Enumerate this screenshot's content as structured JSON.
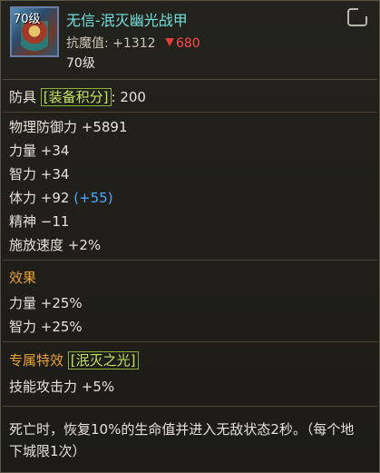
{
  "item": {
    "level_badge": "70级",
    "name": "无信-泯灭幽光战甲",
    "resist_label": "抗魔值:",
    "resist_value": "+1312",
    "resist_diff": "680",
    "level_text": "70级",
    "icon": "armor-item-icon"
  },
  "stats": {
    "armor_label": "防具",
    "equip_score_tag": "[装备积分]",
    "equip_score_value": ": 200",
    "physical_defense": "物理防御力 +5891",
    "strength": "力量 +34",
    "intelligence": "智力 +34",
    "stamina": "体力 +92",
    "stamina_bonus": "(+55)",
    "spirit": "精神 −11",
    "cast_speed": "施放速度 +2%"
  },
  "effects": {
    "title": "效果",
    "strength_pct": "力量 +25%",
    "intelligence_pct": "智力 +25%"
  },
  "special": {
    "title": "专属特效",
    "tag": "[泯灭之光]",
    "skill_attack": "技能攻击力 +5%",
    "description": "死亡时，恢复10%的生命值并进入无敌状态2秒。（每个地下城限1次）"
  },
  "colors": {
    "name": "#73e0dd",
    "section_title": "#e8a234",
    "tag": "#c3e55d",
    "negative": "#ff4a4a",
    "bonus_blue": "#4aa8ff"
  },
  "icons": {
    "share": "share-icon",
    "down_arrow": "down-arrow-icon"
  }
}
